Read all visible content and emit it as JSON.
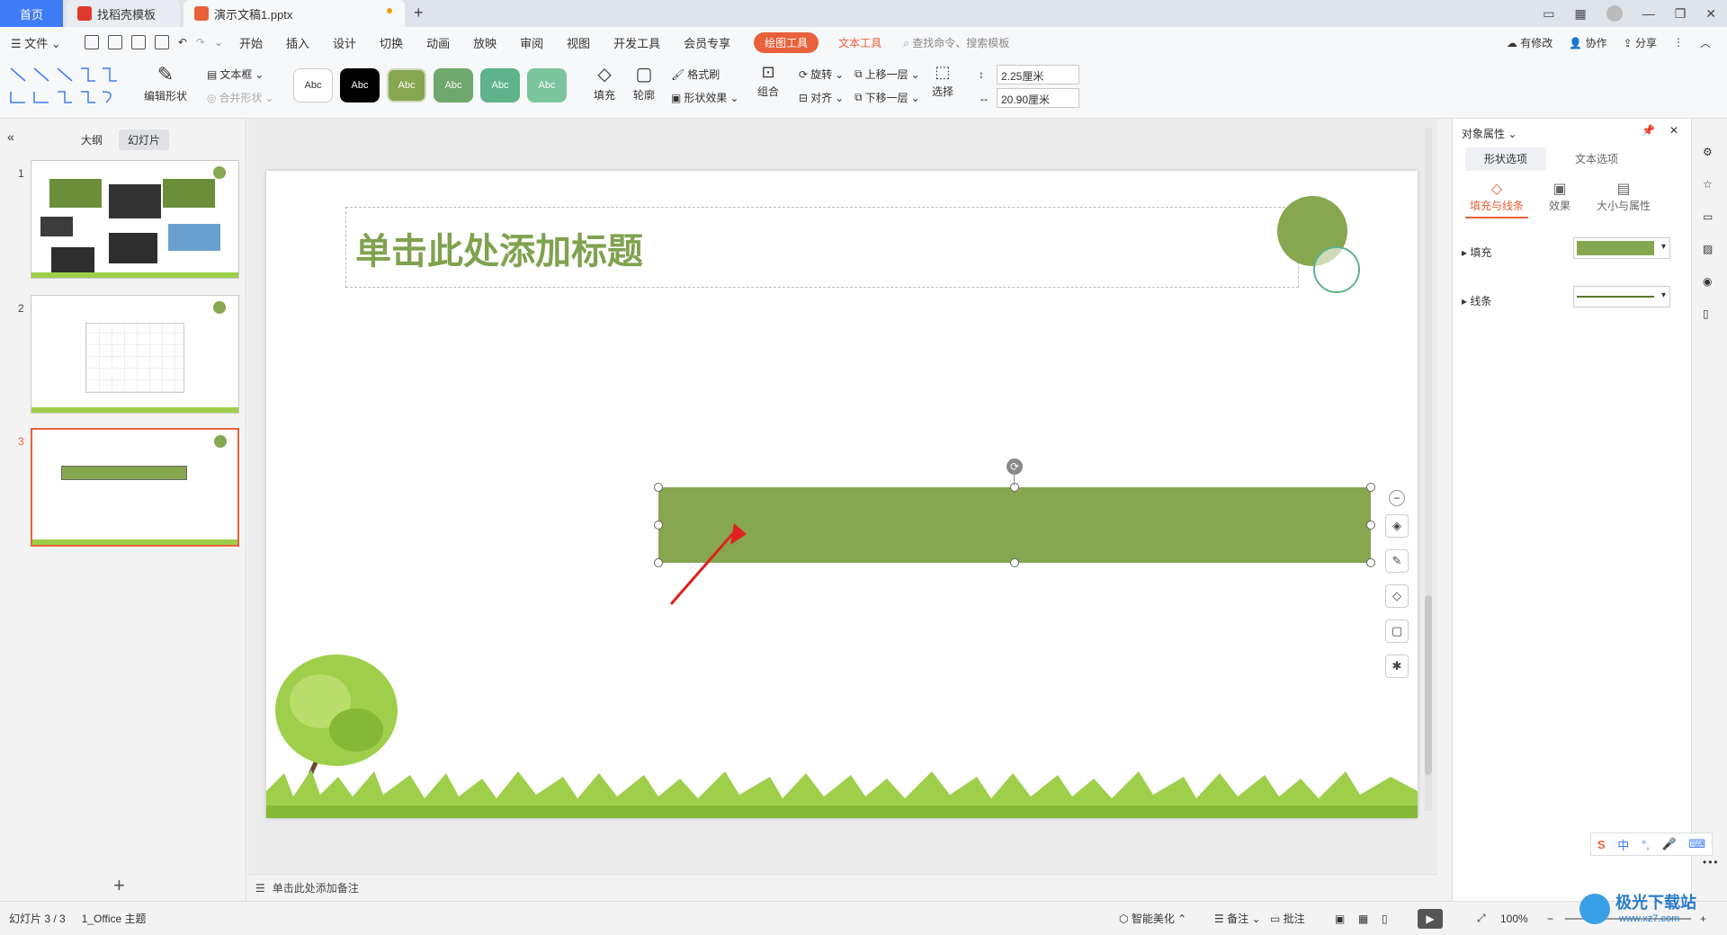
{
  "tabs": {
    "home": "首页",
    "template": "找稻壳模板",
    "document": "演示文稿1.pptx"
  },
  "menu": {
    "file": "文件",
    "items": [
      "开始",
      "插入",
      "设计",
      "切换",
      "动画",
      "放映",
      "审阅",
      "视图",
      "开发工具",
      "会员专享"
    ],
    "draw_tools": "绘图工具",
    "text_tools": "文本工具",
    "search": "查找命令、搜索模板",
    "modify": "有修改",
    "collab": "协作",
    "share": "分享"
  },
  "ribbon": {
    "edit_shape": "编辑形状",
    "textbox": "文本框",
    "merge_shape": "合并形状",
    "style_abc": "Abc",
    "fill": "填充",
    "outline": "轮廓",
    "format_brush": "格式刷",
    "shape_effect": "形状效果",
    "group": "组合",
    "rotate": "旋转",
    "align": "对齐",
    "bring_forward": "上移一层",
    "send_backward": "下移一层",
    "select": "选择",
    "height": "2.25厘米",
    "width": "20.90厘米"
  },
  "left_panel": {
    "outline": "大纲",
    "slides": "幻灯片",
    "slide_numbers": [
      "1",
      "2",
      "3"
    ]
  },
  "slide": {
    "title_placeholder": "单击此处添加标题",
    "shape_color": "#86a650"
  },
  "notes": {
    "placeholder": "单击此处添加备注"
  },
  "props": {
    "header": "对象属性",
    "tab_shape": "形状选项",
    "tab_text": "文本选项",
    "sub_fill_line": "填充与线条",
    "sub_effect": "效果",
    "sub_size": "大小与属性",
    "fill": "填充",
    "line": "线条"
  },
  "status": {
    "slide_info": "幻灯片 3 / 3",
    "theme": "1_Office 主题",
    "smart": "智能美化",
    "notes": "备注",
    "comment": "批注",
    "zoom": "100%"
  },
  "watermark": {
    "brand": "极光下载站",
    "url": "www.xz7.com"
  }
}
